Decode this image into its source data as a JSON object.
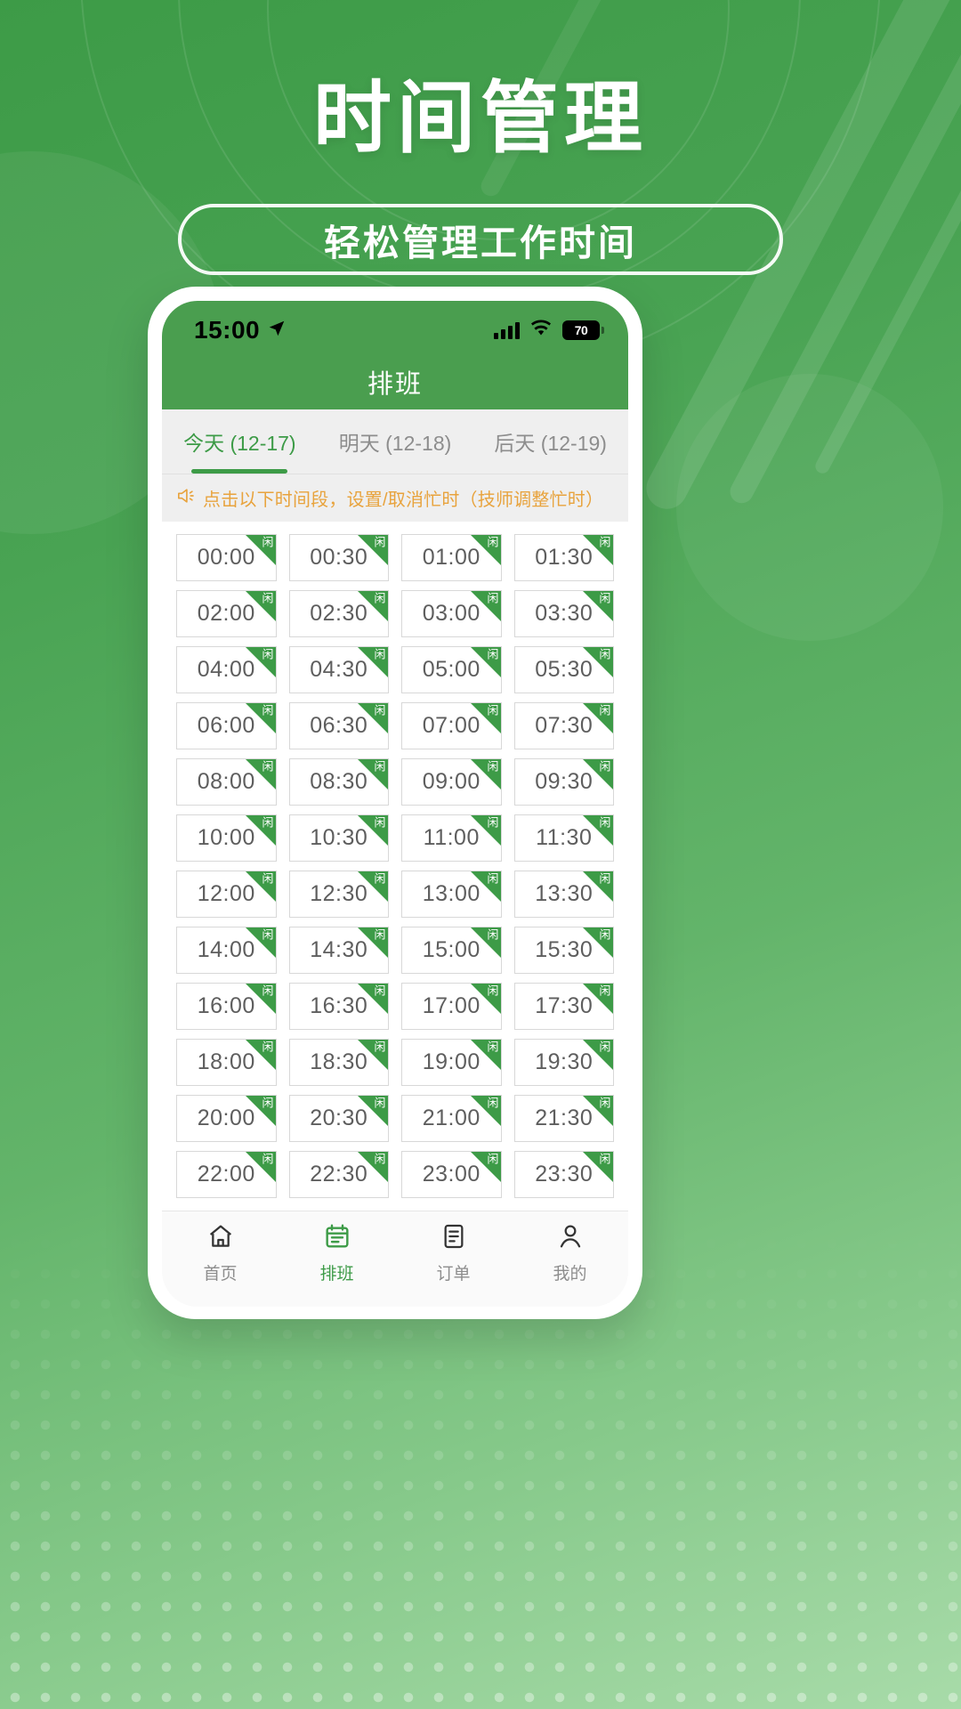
{
  "hero": {
    "title": "时间管理",
    "subtitle": "轻松管理工作时间"
  },
  "phone": {
    "statusbar": {
      "time": "15:00",
      "location_icon": "location-arrow-icon",
      "signal_icon": "cellular-signal-icon",
      "wifi_icon": "wifi-icon",
      "battery_level": "70"
    },
    "navbar": {
      "title": "排班"
    },
    "tabs": [
      {
        "label": "今天 (12-17)",
        "active": true
      },
      {
        "label": "明天 (12-18)",
        "active": false
      },
      {
        "label": "后天 (12-19)",
        "active": false
      }
    ],
    "notice": {
      "icon": "megaphone-icon",
      "text": "点击以下时间段，设置/取消忙时（技师调整忙时）"
    },
    "slot_status_label": "闲",
    "slots": [
      "00:00",
      "00:30",
      "01:00",
      "01:30",
      "02:00",
      "02:30",
      "03:00",
      "03:30",
      "04:00",
      "04:30",
      "05:00",
      "05:30",
      "06:00",
      "06:30",
      "07:00",
      "07:30",
      "08:00",
      "08:30",
      "09:00",
      "09:30",
      "10:00",
      "10:30",
      "11:00",
      "11:30",
      "12:00",
      "12:30",
      "13:00",
      "13:30",
      "14:00",
      "14:30",
      "15:00",
      "15:30",
      "16:00",
      "16:30",
      "17:00",
      "17:30",
      "18:00",
      "18:30",
      "19:00",
      "19:30",
      "20:00",
      "20:30",
      "21:00",
      "21:30",
      "22:00",
      "22:30",
      "23:00",
      "23:30"
    ],
    "tabbar": [
      {
        "label": "首页",
        "icon": "home-icon",
        "active": false
      },
      {
        "label": "排班",
        "icon": "calendar-icon",
        "active": true
      },
      {
        "label": "订单",
        "icon": "document-icon",
        "active": false
      },
      {
        "label": "我的",
        "icon": "user-icon",
        "active": false
      }
    ]
  },
  "colors": {
    "brand_green": "#3d9b47",
    "header_green": "#4a9e4f",
    "notice_orange": "#e8a33d",
    "muted_gray": "#8d8d8d"
  }
}
